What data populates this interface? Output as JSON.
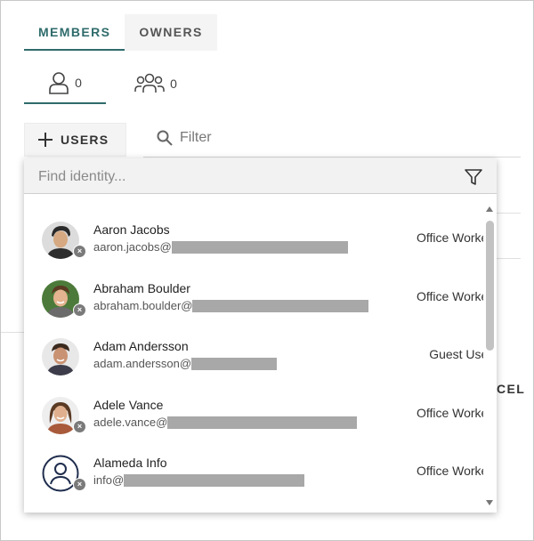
{
  "tabs": [
    {
      "label": "MEMBERS",
      "active": true
    },
    {
      "label": "OWNERS",
      "active": false
    }
  ],
  "sub_tabs": [
    {
      "icon": "user-icon",
      "count": "0",
      "active": true
    },
    {
      "icon": "group-icon",
      "count": "0",
      "active": false
    }
  ],
  "add_users": {
    "icon": "plus-icon",
    "label": "USERS"
  },
  "filter": {
    "icon": "search-icon",
    "placeholder": "Filter"
  },
  "background": {
    "cancel_fragment": "CEL"
  },
  "picker": {
    "placeholder": "Find identity...",
    "filter_icon": "funnel-icon",
    "rows": [
      {
        "name": "Aaron Jacobs",
        "email_prefix": "aaron.jacobs@",
        "role": "Office Worker",
        "avatar": "photo",
        "status_icon": "status-x-icon"
      },
      {
        "name": "Abraham Boulder",
        "email_prefix": "abraham.boulder@",
        "role": "Office Worker",
        "avatar": "photo",
        "status_icon": "status-x-icon"
      },
      {
        "name": "Adam Andersson",
        "email_prefix": "adam.andersson@",
        "role": "Guest User",
        "avatar": "photo",
        "status_icon": null
      },
      {
        "name": "Adele Vance",
        "email_prefix": "adele.vance@",
        "role": "Office Worker",
        "avatar": "photo",
        "status_icon": "status-x-icon"
      },
      {
        "name": "Alameda Info",
        "email_prefix": "info@",
        "role": "Office Worker",
        "avatar": "person-outline-icon",
        "status_icon": "status-x-icon"
      }
    ]
  },
  "colors": {
    "accent": "#2f6b6b",
    "redaction": "#a8a8a8",
    "status": "#7a7a7a"
  }
}
